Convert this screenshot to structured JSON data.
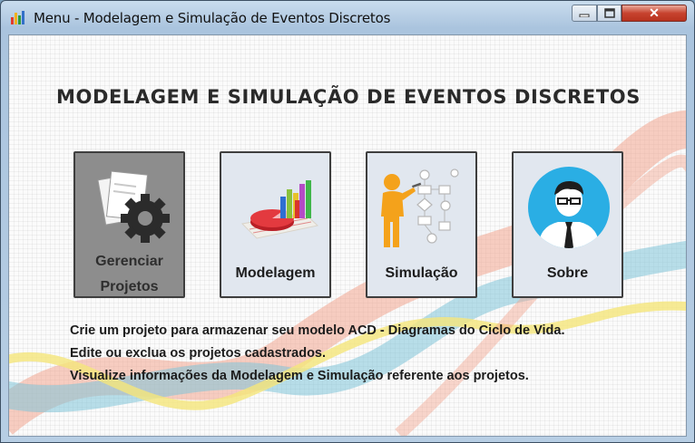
{
  "window": {
    "title": "Menu - Modelagem e Simulação de Eventos Discretos",
    "controls": {
      "close_glyph": "✕"
    }
  },
  "header": {
    "title": "MODELAGEM E SIMULAÇÃO DE EVENTOS DISCRETOS"
  },
  "tiles": [
    {
      "label_line1": "Gerenciar",
      "label_line2": "Projetos",
      "icon": "gear-document-icon",
      "selected": true
    },
    {
      "label": "Modelagem",
      "icon": "bar-pie-chart-icon"
    },
    {
      "label": "Simulação",
      "icon": "person-flowchart-icon"
    },
    {
      "label": "Sobre",
      "icon": "user-avatar-icon"
    }
  ],
  "info_lines": [
    "Crie um projeto para armazenar seu modelo ACD - Diagramas do Ciclo de Vida.",
    "Edite ou exclua os projetos cadastrados.",
    "Visualize informações da Modelagem e Simulação referente aos projetos."
  ],
  "colors": {
    "selected_tile": "#8d8d8d",
    "tile_bg": "#e1e7ef",
    "wave_salmon": "#f2a58f",
    "wave_blue": "#7fc4d8",
    "wave_yellow": "#f5e67a",
    "avatar_bg": "#2aaee4"
  }
}
